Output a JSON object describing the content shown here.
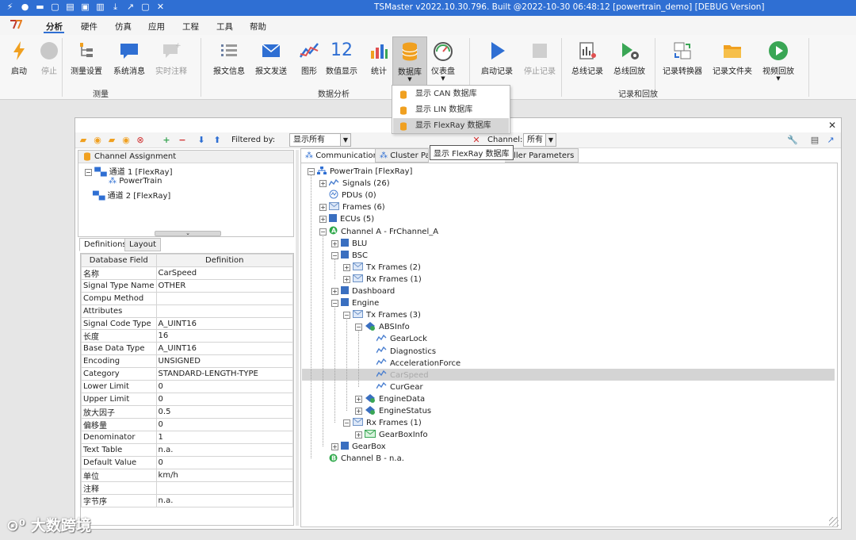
{
  "window": {
    "title": "TSMaster v2022.10.30.796. Built @2022-10-30 06:48:12 [powertrain_demo] [DEBUG Version]"
  },
  "menu": {
    "items": [
      "分析",
      "硬件",
      "仿真",
      "应用",
      "工程",
      "工具",
      "帮助"
    ],
    "active": "分析"
  },
  "ribbon": {
    "measure": {
      "group": "测量",
      "buttons": [
        {
          "label": "启动",
          "icon": "lightning-icon",
          "enabled": true
        },
        {
          "label": "停止",
          "icon": "stop-circle-icon",
          "enabled": false
        },
        {
          "label": "测量设置",
          "icon": "measurement-setup-icon",
          "enabled": true
        },
        {
          "label": "系统消息",
          "icon": "message-icon",
          "enabled": true
        },
        {
          "label": "实时注释",
          "icon": "comment-icon",
          "enabled": false
        }
      ]
    },
    "analysis": {
      "group": "数据分析",
      "buttons": [
        {
          "label": "报文信息",
          "icon": "list-icon"
        },
        {
          "label": "报文发送",
          "icon": "send-mail-icon"
        },
        {
          "label": "图形",
          "icon": "line-chart-icon"
        },
        {
          "label": "数值显示",
          "icon": "number-display-icon",
          "glyph": "12"
        },
        {
          "label": "统计",
          "icon": "bar-stats-icon"
        },
        {
          "label": "数据库",
          "icon": "database-icon"
        },
        {
          "label": "仪表盘",
          "icon": "gauge-icon"
        }
      ]
    },
    "record": {
      "group": "记录和回放",
      "buttons": [
        {
          "label": "启动记录",
          "icon": "play-icon",
          "enabled": true
        },
        {
          "label": "停止记录",
          "icon": "stop-square-icon",
          "enabled": false
        },
        {
          "label": "总线记录",
          "icon": "bus-record-icon",
          "enabled": true
        },
        {
          "label": "总线回放",
          "icon": "bus-replay-icon",
          "enabled": true
        },
        {
          "label": "记录转换器",
          "icon": "converter-icon",
          "enabled": true
        },
        {
          "label": "记录文件夹",
          "icon": "folder-icon",
          "enabled": true
        },
        {
          "label": "视频回放",
          "icon": "video-play-icon",
          "enabled": true
        }
      ]
    }
  },
  "db_menu": {
    "items": [
      "显示 CAN 数据库",
      "显示 LIN 数据库",
      "显示 FlexRay 数据库"
    ],
    "highlighted": 2
  },
  "tooltip": "显示 FlexRay 数据库",
  "toolbar": {
    "filter_label": "Filtered by:",
    "filter_value": "显示所有",
    "channel_label": "Channel:",
    "channel_value": "所有"
  },
  "left_tree": {
    "header": "Channel Assignment",
    "items": [
      {
        "label": "通道 1 [FlexRay]",
        "level": 0,
        "expanded": true
      },
      {
        "label": "PowerTrain",
        "level": 1
      },
      {
        "label": "通道 2 [FlexRay]",
        "level": 0
      }
    ]
  },
  "left_tabs": [
    "Definitions",
    "Layout"
  ],
  "definitions": {
    "headers": [
      "Database Field",
      "Definition"
    ],
    "rows": [
      [
        "名称",
        "CarSpeed"
      ],
      [
        "Signal Type Name",
        "OTHER"
      ],
      [
        "Compu Method",
        ""
      ],
      [
        "Attributes",
        ""
      ],
      [
        "Signal Code Type",
        "A_UINT16"
      ],
      [
        "长度",
        "16"
      ],
      [
        "Base Data Type",
        "A_UINT16"
      ],
      [
        "Encoding",
        "UNSIGNED"
      ],
      [
        "Category",
        "STANDARD-LENGTH-TYPE"
      ],
      [
        "Lower Limit",
        "0"
      ],
      [
        "Upper Limit",
        "0"
      ],
      [
        "放大因子",
        "0.5"
      ],
      [
        "偏移量",
        "0"
      ],
      [
        "Denominator",
        "1"
      ],
      [
        "Text Table",
        "n.a."
      ],
      [
        "Default Value",
        "0"
      ],
      [
        "单位",
        "km/h"
      ],
      [
        "注释",
        ""
      ],
      [
        "字节序",
        "n.a."
      ]
    ]
  },
  "right_tabs": [
    "Communication",
    "Cluster Pa",
    "oller Parameters"
  ],
  "right_tree": [
    {
      "label": "PowerTrain [FlexRay]",
      "level": 0,
      "exp": "-",
      "icon": "network"
    },
    {
      "label": "Signals (26)",
      "level": 1,
      "exp": "+",
      "icon": "signal"
    },
    {
      "label": "PDUs (0)",
      "level": 1,
      "exp": "",
      "icon": "pdu"
    },
    {
      "label": "Frames (6)",
      "level": 1,
      "exp": "+",
      "icon": "frame"
    },
    {
      "label": "ECUs (5)",
      "level": 1,
      "exp": "+",
      "icon": "ecu"
    },
    {
      "label": "Channel A - FrChannel_A",
      "level": 1,
      "exp": "-",
      "icon": "chan-a"
    },
    {
      "label": "BLU",
      "level": 2,
      "exp": "+",
      "icon": "ecu"
    },
    {
      "label": "BSC",
      "level": 2,
      "exp": "-",
      "icon": "ecu"
    },
    {
      "label": "Tx Frames (2)",
      "level": 3,
      "exp": "+",
      "icon": "frame"
    },
    {
      "label": "Rx Frames (1)",
      "level": 3,
      "exp": "+",
      "icon": "frame"
    },
    {
      "label": "Dashboard",
      "level": 2,
      "exp": "+",
      "icon": "ecu"
    },
    {
      "label": "Engine",
      "level": 2,
      "exp": "-",
      "icon": "ecu"
    },
    {
      "label": "Tx Frames (3)",
      "level": 3,
      "exp": "-",
      "icon": "frame"
    },
    {
      "label": "ABSInfo",
      "level": 4,
      "exp": "-",
      "icon": "frame-tx"
    },
    {
      "label": "GearLock",
      "level": 5,
      "exp": "",
      "icon": "signal"
    },
    {
      "label": "Diagnostics",
      "level": 5,
      "exp": "",
      "icon": "signal"
    },
    {
      "label": "AccelerationForce",
      "level": 5,
      "exp": "",
      "icon": "signal"
    },
    {
      "label": "CarSpeed",
      "level": 5,
      "exp": "",
      "icon": "signal",
      "selected": true
    },
    {
      "label": "CurGear",
      "level": 5,
      "exp": "",
      "icon": "signal"
    },
    {
      "label": "EngineData",
      "level": 4,
      "exp": "+",
      "icon": "frame-tx"
    },
    {
      "label": "EngineStatus",
      "level": 4,
      "exp": "+",
      "icon": "frame-tx"
    },
    {
      "label": "Rx Frames (1)",
      "level": 3,
      "exp": "-",
      "icon": "frame"
    },
    {
      "label": "GearBoxInfo",
      "level": 4,
      "exp": "+",
      "icon": "frame-rx"
    },
    {
      "label": "GearBox",
      "level": 2,
      "exp": "+",
      "icon": "ecu"
    },
    {
      "label": "Channel B - n.a.",
      "level": 1,
      "exp": "",
      "icon": "chan-b"
    }
  ],
  "watermark": "大数跨境",
  "colors": {
    "titlebar": "#2f6fd3",
    "accent": "#2f6fd3",
    "selected_row": "#d4d4d4",
    "db_orange": "#f0a020"
  }
}
